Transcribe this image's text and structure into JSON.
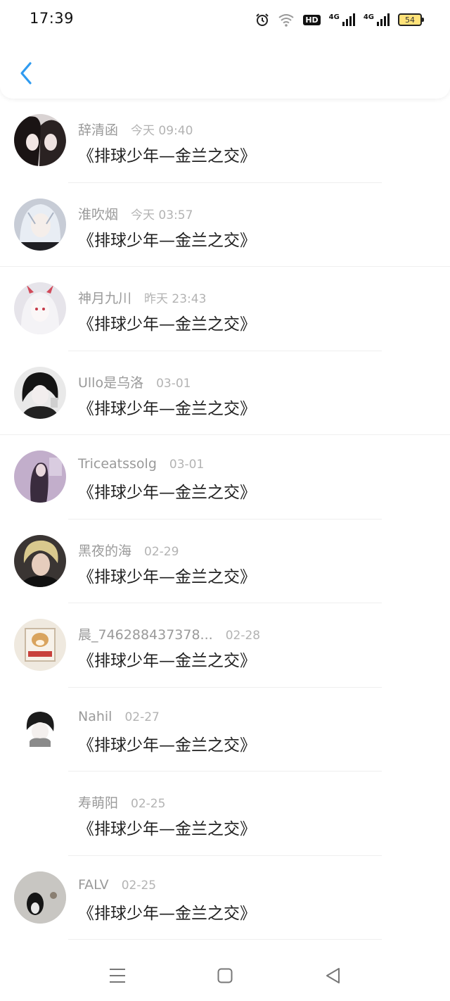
{
  "status_bar": {
    "time": "17:39",
    "hd_label": "HD",
    "signal_1_label": "4G",
    "signal_2_label": "4G",
    "battery_level": "54",
    "icons": [
      "alarm-icon",
      "wifi-icon",
      "hd-icon",
      "signal-4g-icon",
      "signal-4g-icon",
      "battery-icon"
    ]
  },
  "header": {
    "back_icon": "chevron-left-icon",
    "accent_color": "#2f9bf0"
  },
  "items": [
    {
      "name": "辞清函",
      "time": "今天 09:40",
      "message": "《排球少年—金兰之交》",
      "avatar": "dark-portrait",
      "has_avatar": true
    },
    {
      "name": "淮吹烟",
      "time": "今天 03:57",
      "message": "《排球少年—金兰之交》",
      "avatar": "white-hair-anime",
      "has_avatar": true
    },
    {
      "name": "神月九川",
      "time": "昨天 23:43",
      "message": "《排球少年—金兰之交》",
      "avatar": "horned-anime",
      "has_avatar": true
    },
    {
      "name": "Ullo是乌洛",
      "time": "03-01",
      "message": "《排球少年—金兰之交》",
      "avatar": "dark-anime",
      "has_avatar": true
    },
    {
      "name": "Triceatssolg",
      "time": "03-01",
      "message": "《排球少年—金兰之交》",
      "avatar": "purple-figure",
      "has_avatar": true
    },
    {
      "name": "黑夜的海",
      "time": "02-29",
      "message": "《排球少年—金兰之交》",
      "avatar": "blonde-person",
      "has_avatar": true
    },
    {
      "name": "晨_746288437378...",
      "time": "02-28",
      "message": "《排球少年—金兰之交》",
      "avatar": "shiba-dog",
      "has_avatar": true
    },
    {
      "name": "Nahil",
      "time": "02-27",
      "message": "《排球少年—金兰之交》",
      "avatar": "chibi-boy",
      "has_avatar": true
    },
    {
      "name": "寿萌阳",
      "time": "02-25",
      "message": "《排球少年—金兰之交》",
      "avatar": "none",
      "has_avatar": false
    },
    {
      "name": "FALV",
      "time": "02-25",
      "message": "《排球少年—金兰之交》",
      "avatar": "penguin",
      "has_avatar": true
    }
  ],
  "nav_bar": {
    "icons": [
      "menu-icon",
      "home-icon",
      "back-triangle-icon"
    ]
  }
}
